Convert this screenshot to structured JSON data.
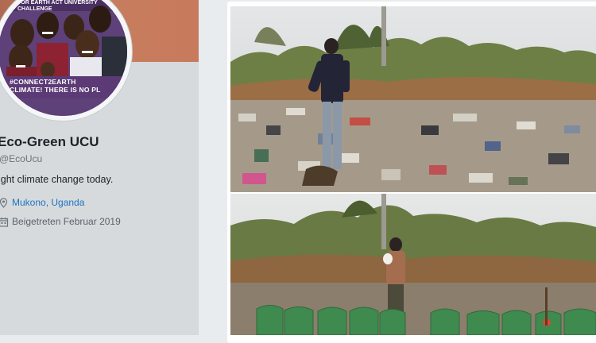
{
  "profile": {
    "avatar_top_text": "FOR EARTH ACT UNIVERSITY CHALLENGE",
    "avatar_band_line1": "#CONNECT2EARTH",
    "avatar_band_line2": "CLIMATE! THERE IS NO PL",
    "name": "Eco-Green UCU",
    "handle": "@EcoUcu",
    "bio": "ight climate change today.",
    "location": "Mukono, Uganda",
    "joined": "Beigetreten Februar 2019",
    "icons": {
      "location": "location-pin-icon",
      "joined": "calendar-icon"
    },
    "colors": {
      "link": "#1b74c0",
      "banner": "#c97d5f",
      "avatar_band": "#5b3a76"
    }
  },
  "tweet_media": {
    "photos": [
      {
        "name": "before-cleanup-photo"
      },
      {
        "name": "after-cleanup-photo"
      }
    ]
  }
}
